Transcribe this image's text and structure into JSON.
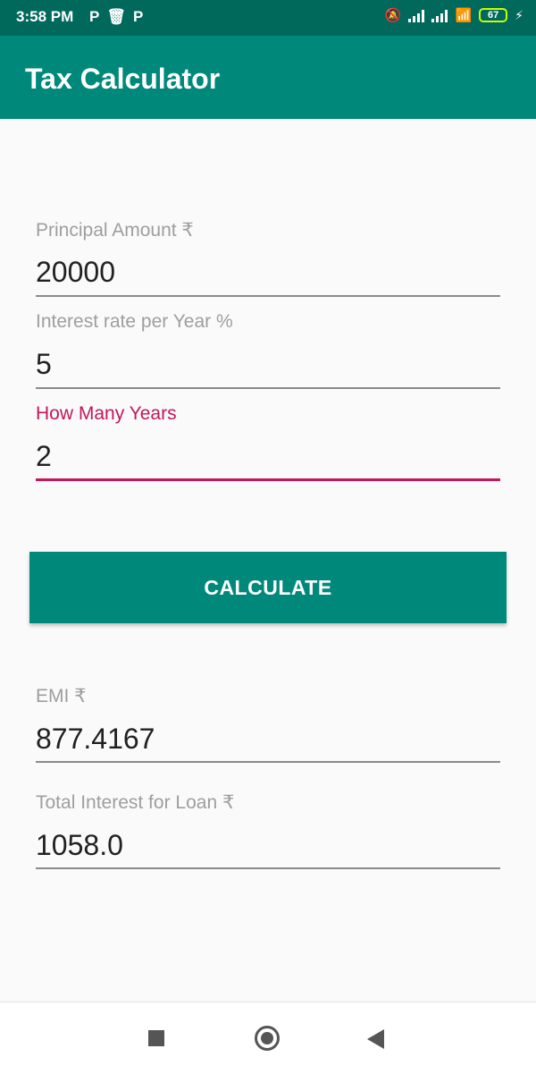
{
  "status_bar": {
    "time": "3:58 PM",
    "left_icons": [
      "P",
      "trash-icon",
      "P"
    ],
    "battery": "67"
  },
  "app_bar": {
    "title": "Tax Calculator"
  },
  "form": {
    "principal": {
      "label": "Principal Amount ₹",
      "value": "20000"
    },
    "interest": {
      "label": "Interest rate per Year %",
      "value": "5"
    },
    "years": {
      "label": "How Many Years",
      "value": "2"
    }
  },
  "calculate_button": {
    "label": "CALCULATE"
  },
  "results": {
    "emi": {
      "label": "EMI ₹",
      "value": "877.4167"
    },
    "total_interest": {
      "label": "Total Interest for Loan ₹",
      "value": "1058.0"
    }
  },
  "colors": {
    "status_bar": "#00695c",
    "primary": "#00897b",
    "accent": "#c2185b",
    "background": "#fafafa"
  }
}
